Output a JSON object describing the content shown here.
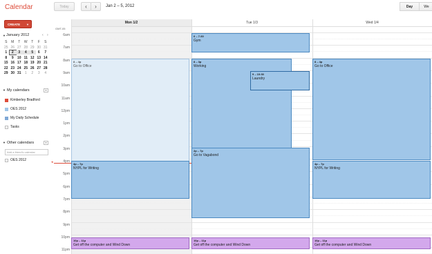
{
  "app": {
    "title": "Calendar"
  },
  "toolbar": {
    "today_label": "Today",
    "prev_icon": "‹",
    "next_icon": "›",
    "date_range": "Jan 2 – 5, 2012",
    "views": [
      "Day",
      "We"
    ]
  },
  "sidebar": {
    "create_label": "CREATE",
    "mini_calendar": {
      "month": "January 2012",
      "dow": [
        "S",
        "M",
        "T",
        "W",
        "T",
        "F",
        "S"
      ],
      "weeks": [
        [
          "25",
          "26",
          "27",
          "28",
          "29",
          "30",
          "31"
        ],
        [
          "1",
          "2",
          "3",
          "4",
          "5",
          "6",
          "7"
        ],
        [
          "8",
          "9",
          "10",
          "11",
          "12",
          "13",
          "14"
        ],
        [
          "15",
          "16",
          "17",
          "18",
          "19",
          "20",
          "21"
        ],
        [
          "22",
          "23",
          "24",
          "25",
          "26",
          "27",
          "28"
        ],
        [
          "29",
          "30",
          "31",
          "1",
          "2",
          "3",
          "4"
        ]
      ]
    },
    "my_calendars_label": "My calendars",
    "my_calendars": [
      {
        "name": "Kimberley Bradford",
        "color": "#dd4b39"
      },
      {
        "name": "OES 2012",
        "color": "#a0c6e8"
      },
      {
        "name": "My Daily Schedule",
        "color": "#7fa8d6"
      },
      {
        "name": "Tasks",
        "color": ""
      }
    ],
    "other_calendars_label": "Other calendars",
    "friend_placeholder": "Add a friend's calendar",
    "other_calendars": [
      {
        "name": "OES 2012",
        "color": ""
      }
    ]
  },
  "grid": {
    "timezone": "GMT-05",
    "days": [
      "Mon 1/2",
      "Tue 1/3",
      "Wed 1/4"
    ],
    "hours": [
      "6am",
      "7am",
      "8am",
      "9am",
      "10am",
      "11am",
      "12pm",
      "1pm",
      "2pm",
      "3pm",
      "4pm",
      "5pm",
      "6pm",
      "7pm",
      "8pm",
      "9pm",
      "10pm",
      "11pm"
    ],
    "events": [
      {
        "day": 1,
        "time": "6 – 7:30",
        "title": "Gym"
      },
      {
        "day": 0,
        "time": "8 – 4p",
        "title": "Go to Office"
      },
      {
        "day": 1,
        "time": "8 – 3p",
        "title": "Working"
      },
      {
        "day": 1,
        "time": "9 – 10:30",
        "title": "Laundry"
      },
      {
        "day": 2,
        "time": "8 – 4p",
        "title": "Go to Office"
      },
      {
        "day": 1,
        "time": "2p – 7p",
        "title": "Go to Vagabond"
      },
      {
        "day": 0,
        "time": "4p – 7p",
        "title": "NYPL for Writing"
      },
      {
        "day": 2,
        "time": "4p – 7p",
        "title": "NYPL for Writing"
      },
      {
        "day": 0,
        "time": "10p – 11p",
        "title": "Get off the computer and Wind Down"
      },
      {
        "day": 1,
        "time": "10p – 11p",
        "title": "Get off the computer and Wind Down"
      },
      {
        "day": 2,
        "time": "10p – 11p",
        "title": "Get off the computer and Wind Down"
      }
    ]
  }
}
